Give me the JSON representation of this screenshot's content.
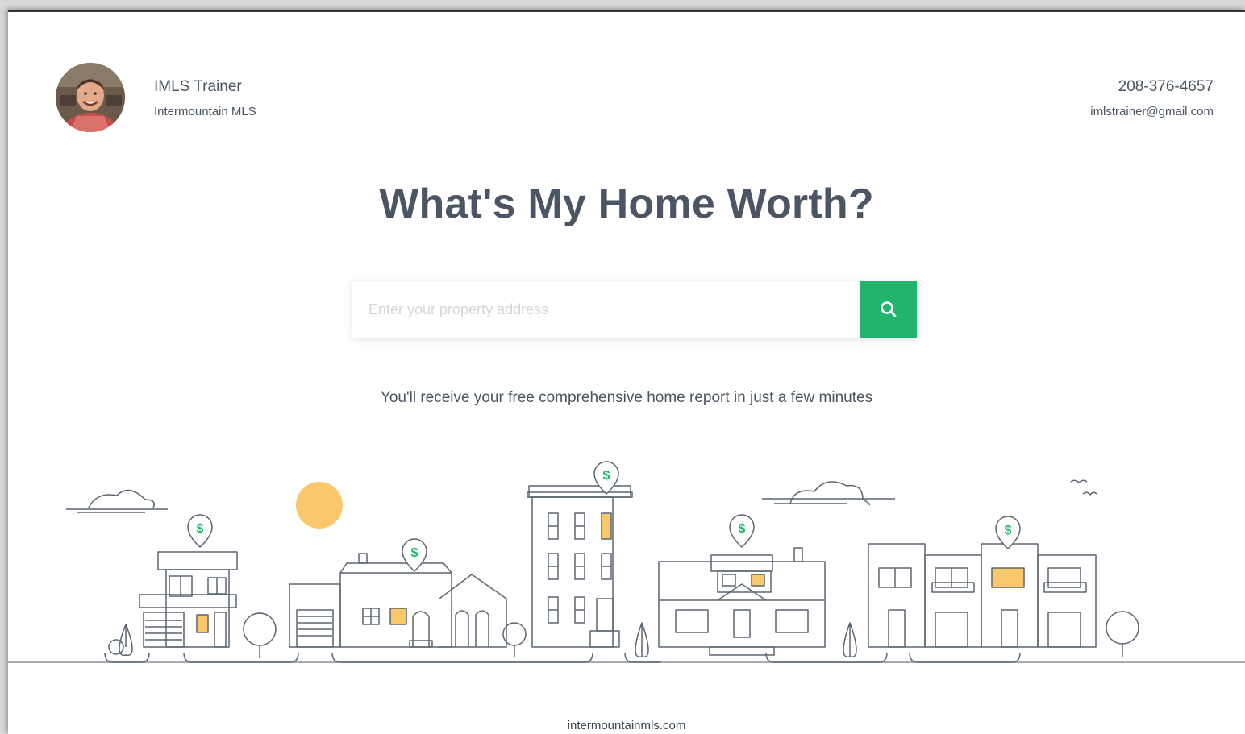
{
  "agent": {
    "name": "IMLS Trainer",
    "company": "Intermountain MLS",
    "phone": "208-376-4657",
    "email": "imlstrainer@gmail.com"
  },
  "hero": {
    "title": "What's My Home Worth?",
    "subtitle": "You'll receive your free comprehensive home report in just a few minutes"
  },
  "search": {
    "placeholder": "Enter your property address",
    "value": "",
    "button_icon": "search-icon"
  },
  "illustration": {
    "pin_symbol": "$",
    "colors": {
      "line": "#5c6570",
      "pin": "#21b46c",
      "sun": "#f9c86b",
      "window": "#f9c86b"
    }
  },
  "footer": {
    "site": "intermountainmls.com"
  },
  "colors": {
    "accent": "#21b46c",
    "text": "#4a5560"
  }
}
